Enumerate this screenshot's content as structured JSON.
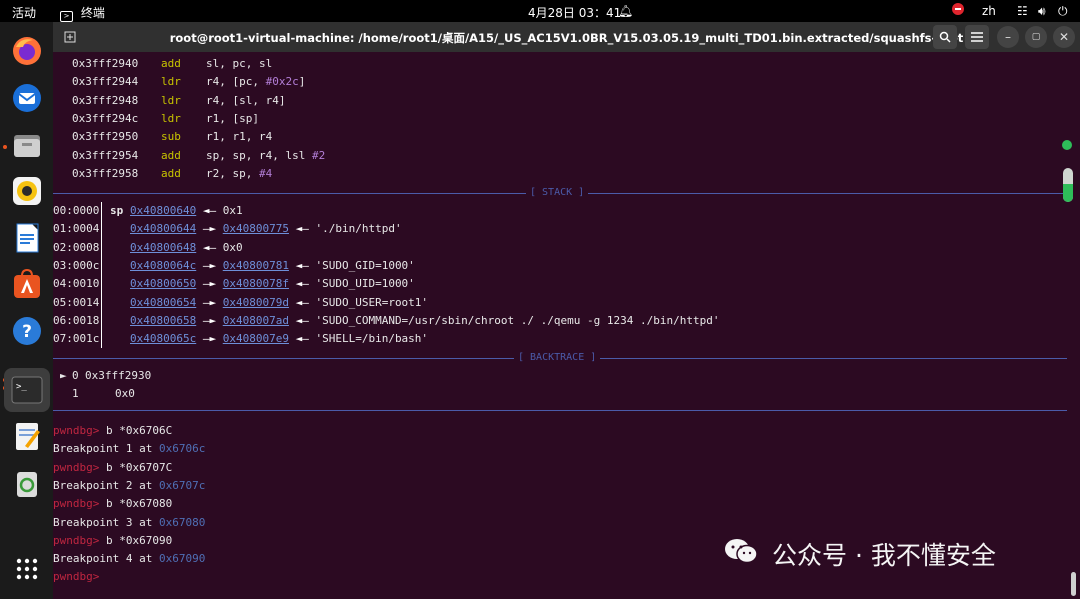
{
  "topbar": {
    "activities": "活动",
    "app_name": "终端",
    "clock": "4月28日 03：41",
    "lang": "zh"
  },
  "window": {
    "title": "root@root1-virtual-machine: /home/root1/桌面/A15/_US_AC15V1.0BR_V15.03.05.19_multi_TD01.bin.extracted/squashfs-root"
  },
  "disasm": [
    {
      "addr": "0x3fff2940",
      "mn": "add",
      "op": "sl, pc, sl",
      "imm": ""
    },
    {
      "addr": "0x3fff2944",
      "mn": "ldr",
      "op": "r4, [pc, ",
      "imm": "#0x2c",
      "post": "]"
    },
    {
      "addr": "0x3fff2948",
      "mn": "ldr",
      "op": "r4, [sl, r4]",
      "imm": ""
    },
    {
      "addr": "0x3fff294c",
      "mn": "ldr",
      "op": "r1, [sp]",
      "imm": ""
    },
    {
      "addr": "0x3fff2950",
      "mn": "sub",
      "op": "r1, r1, r4",
      "imm": ""
    },
    {
      "addr": "0x3fff2954",
      "mn": "add",
      "op": "sp, sp, r4, lsl ",
      "imm": "#2"
    },
    {
      "addr": "0x3fff2958",
      "mn": "add",
      "op": "r2, sp, ",
      "imm": "#4"
    }
  ],
  "sections": {
    "stack": "[ STACK ]",
    "backtrace": "[ BACKTRACE ]"
  },
  "stack": [
    {
      "idx": "00:0000",
      "reg": "sp",
      "ptr": "0x40800640",
      "ptr2": "",
      "val": "0x1"
    },
    {
      "idx": "01:0004",
      "reg": "",
      "ptr": "0x40800644",
      "ptr2": "0x40800775",
      "val": "'./bin/httpd'"
    },
    {
      "idx": "02:0008",
      "reg": "",
      "ptr": "0x40800648",
      "ptr2": "",
      "val": "0x0"
    },
    {
      "idx": "03:000c",
      "reg": "",
      "ptr": "0x4080064c",
      "ptr2": "0x40800781",
      "val": "'SUDO_GID=1000'"
    },
    {
      "idx": "04:0010",
      "reg": "",
      "ptr": "0x40800650",
      "ptr2": "0x4080078f",
      "val": "'SUDO_UID=1000'"
    },
    {
      "idx": "05:0014",
      "reg": "",
      "ptr": "0x40800654",
      "ptr2": "0x4080079d",
      "val": "'SUDO_USER=root1'"
    },
    {
      "idx": "06:0018",
      "reg": "",
      "ptr": "0x40800658",
      "ptr2": "0x408007ad",
      "val": "'SUDO_COMMAND=/usr/sbin/chroot ./ ./qemu -g 1234 ./bin/httpd'"
    },
    {
      "idx": "07:001c",
      "reg": "",
      "ptr": "0x4080065c",
      "ptr2": "0x408007e9",
      "val": "'SHELL=/bin/bash'"
    }
  ],
  "backtrace": [
    {
      "marker": "►",
      "num": "0",
      "addr": "0x3fff2930"
    },
    {
      "marker": "",
      "num": "1",
      "addr": "0x0"
    }
  ],
  "console": {
    "prompt": "pwndbg>",
    "cmds": [
      {
        "cmd": "b *0x6706C",
        "resp": "Breakpoint 1 at ",
        "addr": "0x6706c"
      },
      {
        "cmd": "b *0x6707C",
        "resp": "Breakpoint 2 at ",
        "addr": "0x6707c"
      },
      {
        "cmd": "b *0x67080",
        "resp": "Breakpoint 3 at ",
        "addr": "0x67080"
      },
      {
        "cmd": "b *0x67090",
        "resp": "Breakpoint 4 at ",
        "addr": "0x67090"
      }
    ]
  },
  "watermark": {
    "text": "公众号 · 我不懂安全"
  },
  "colors": {
    "terminal_bg": "#2c0a22",
    "mnemonic": "#c7c400",
    "immediate": "#b27ed6",
    "pointer": "#6e8fd9",
    "prompt": "#c02640",
    "separator": "#4b5ba9"
  }
}
